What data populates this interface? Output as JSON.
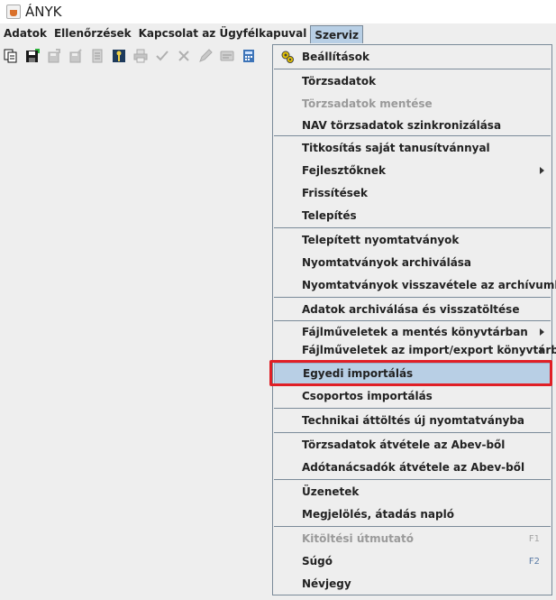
{
  "window": {
    "title": "ÁNYK"
  },
  "menubar": {
    "items": [
      "Adatok",
      "Ellenőrzések",
      "Kapcsolat az Ügyfélkapuval",
      "Szerviz"
    ],
    "active": "Szerviz"
  },
  "toolbar": {
    "icons": [
      "copy-icon",
      "save-icon",
      "export-icon",
      "import-icon",
      "document-icon",
      "key-icon",
      "print-icon",
      "check-icon",
      "delete-icon",
      "edit-icon",
      "card-icon",
      "calculator-icon"
    ]
  },
  "menu": {
    "settings": "Beállítások",
    "master_data": "Törzsadatok",
    "master_data_save": "Törzsadatok mentése",
    "nav_sync": "NAV törzsadatok szinkronizálása",
    "encryption": "Titkosítás saját tanusítvánnyal",
    "developers": "Fejlesztőknek",
    "updates": "Frissítések",
    "install": "Telepítés",
    "installed_forms": "Telepített nyomtatványok",
    "archive_forms": "Nyomtatványok archiválása",
    "restore_forms": "Nyomtatványok visszavétele az archívumból",
    "archive_data": "Adatok archiválása és visszatöltése",
    "file_ops_save": "Fájlműveletek a mentés könyvtárban",
    "file_ops_import": "Fájlműveletek az import/export könyvtárban",
    "single_import": "Egyedi importálás",
    "group_import": "Csoportos importálás",
    "tech_transfer": "Technikai áttöltés új nyomtatványba",
    "abev_master": "Törzsadatok átvétele az Abev-ből",
    "abev_advisors": "Adótanácsadók átvétele az Abev-ből",
    "messages": "Üzenetek",
    "log": "Megjelölés, átadás napló",
    "fill_guide": "Kitöltési útmutató",
    "fill_guide_key": "F1",
    "help": "Súgó",
    "help_key": "F2",
    "about": "Névjegy"
  },
  "colors": {
    "selected_bg": "#b8cfe5",
    "highlight": "#e01f26"
  }
}
